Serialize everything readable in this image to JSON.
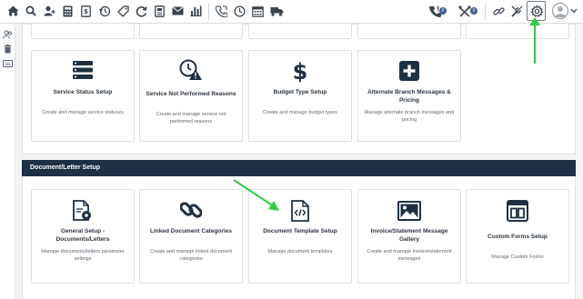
{
  "toolbar": {
    "left_icons": [
      "home-icon",
      "search-icon",
      "user-add-icon",
      "calculator-icon",
      "invoice-icon",
      "clock-back-icon",
      "tag-icon",
      "refresh-icon",
      "document-icon",
      "mail-icon",
      "bar-chart-icon"
    ],
    "mid_icons": [
      "phone-call-icon",
      "clock-icon",
      "calendar-icon",
      "truck-icon"
    ],
    "right_icons": [
      "phone-alert-icon",
      "tools-icon",
      "link-icon",
      "wrench-icon",
      "settings-icon",
      "avatar-icon"
    ],
    "phone_badge": "0",
    "tools_badge": "0"
  },
  "sidebar": {
    "icons": [
      "users-icon",
      "trash-icon",
      "keyboard-icon"
    ]
  },
  "service_section": {
    "cards": [
      {
        "icon": "service-status-icon",
        "title": "Service Status Setup",
        "desc": "Create and manage service statuses"
      },
      {
        "icon": "service-not-performed-icon",
        "title": "Service Not Performed Reasons",
        "desc": "Create and manage service not performed reasons"
      },
      {
        "icon": "dollar-icon",
        "title": "Budget Type Setup",
        "desc": "Create and manage budget types"
      },
      {
        "icon": "plus-box-icon",
        "title": "Alternate Branch Messages & Pricing",
        "desc": "Manage alternate branch messages and pricing"
      }
    ]
  },
  "document_section": {
    "header": "Document/Letter Setup",
    "cards": [
      {
        "icon": "document-settings-icon",
        "title": "General Setup - Documents/Letters",
        "desc": "Manage documents/letters parameter settings"
      },
      {
        "icon": "chain-link-icon",
        "title": "Linked Document Categories",
        "desc": "Create and manage linked document categories"
      },
      {
        "icon": "code-document-icon",
        "title": "Document Template Setup",
        "desc": "Manage document templates"
      },
      {
        "icon": "image-gallery-icon",
        "title": "Invoice/Statement Message Gallery",
        "desc": "Create and manage invoice/statement messages"
      },
      {
        "icon": "form-layout-icon",
        "title": "Custom Forms Setup",
        "desc": "Manage Custom Forms"
      }
    ]
  },
  "colors": {
    "header_bg": "#1f3044",
    "annotation_arrow": "#2ecc40",
    "icon_dark": "#1f3044"
  }
}
